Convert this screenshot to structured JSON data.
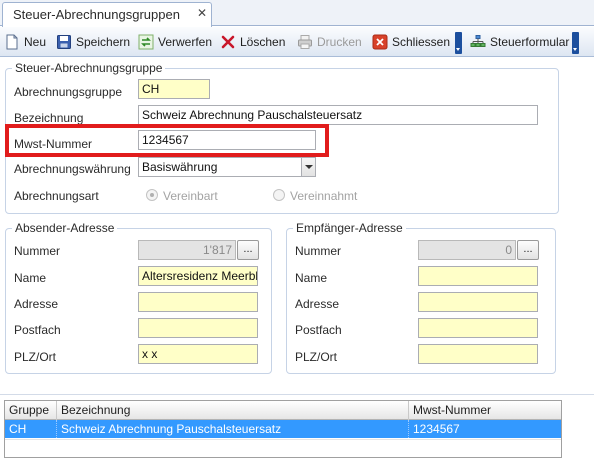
{
  "tab": {
    "title": "Steuer-Abrechnungsgruppen"
  },
  "toolbar": {
    "new": "Neu",
    "save": "Speichern",
    "discard": "Verwerfen",
    "delete": "Löschen",
    "print": "Drucken",
    "close": "Schliessen",
    "tax_form": "Steuerformular"
  },
  "group": {
    "title": "Steuer-Abrechnungsgruppe",
    "code_label": "Abrechnungsgruppe",
    "code_value": "CH",
    "name_label": "Bezeichnung",
    "name_value": "Schweiz Abrechnung Pauschalsteuersatz",
    "vat_label": "Mwst-Nummer",
    "vat_value": "1234567",
    "currency_label": "Abrechnungswährung",
    "currency_value": "Basiswährung",
    "type_label": "Abrechnungsart",
    "type_option_1": "Vereinbart",
    "type_option_2": "Vereinnahmt",
    "type_selected": "Vereinbart"
  },
  "sender": {
    "title": "Absender-Adresse",
    "number_label": "Nummer",
    "number_value": "1'817",
    "name_label": "Name",
    "name_value": "Altersresidenz Meerblick",
    "address_label": "Adresse",
    "address_value": "",
    "pobox_label": "Postfach",
    "pobox_value": "",
    "zip_label": "PLZ/Ort",
    "zip_value": "x x"
  },
  "recipient": {
    "title": "Empfänger-Adresse",
    "number_label": "Nummer",
    "number_value": "0",
    "name_label": "Name",
    "name_value": "",
    "address_label": "Adresse",
    "address_value": "",
    "pobox_label": "Postfach",
    "pobox_value": "",
    "zip_label": "PLZ/Ort",
    "zip_value": ""
  },
  "grid": {
    "columns": [
      "Gruppe",
      "Bezeichnung",
      "Mwst-Nummer"
    ],
    "rows": [
      [
        "CH",
        "Schweiz Abrechnung Pauschalsteuersatz",
        "1234567"
      ]
    ]
  },
  "colors": {
    "highlight": "#e11c1c",
    "selected_row": "#3399ff",
    "required_field": "#ffffc8",
    "toolbar_dropdown": "#1c4f9e"
  }
}
